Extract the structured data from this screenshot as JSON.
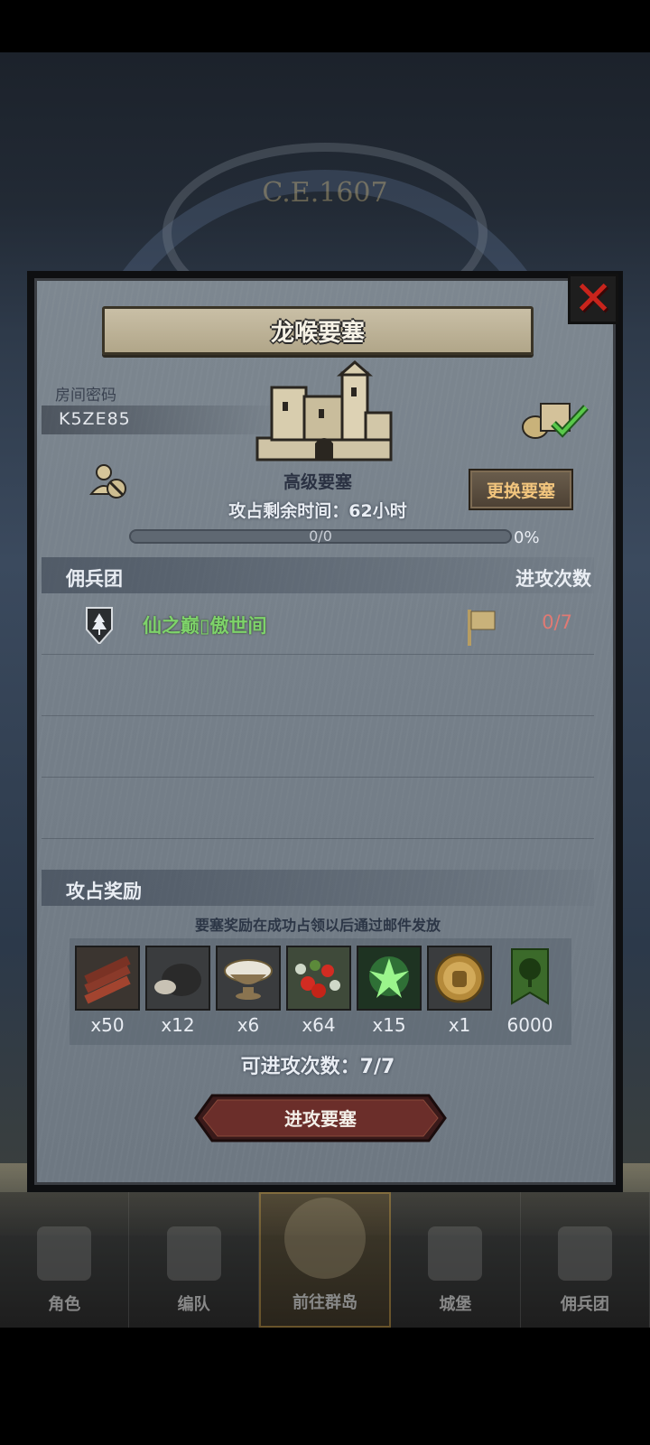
{
  "background": {
    "era_label": "C.E.1607"
  },
  "modal": {
    "title": "龙喉要塞",
    "room_password_label": "房间密码",
    "room_password": "K5ZE85",
    "fortress_type": "高级要塞",
    "change_button": "更换要塞",
    "remaining_time": "攻占剩余时间：62小时",
    "progress": {
      "text": "0/0",
      "percent_text": "0%",
      "value": 0
    },
    "mercenary_header": "佣兵团",
    "attack_count_header": "进攻次数",
    "mercenaries": [
      {
        "name": "仙之巅▯傲世间",
        "attacks": "0/7",
        "icon": "pine-tree-shield-icon"
      }
    ],
    "reward_header": "攻占奖励",
    "reward_note": "要塞奖励在成功占领以后通过邮件发放",
    "rewards": [
      {
        "icon": "wood-logs-icon",
        "qty": "x50"
      },
      {
        "icon": "ore-rock-icon",
        "qty": "x12"
      },
      {
        "icon": "silver-bowl-icon",
        "qty": "x6"
      },
      {
        "icon": "berries-icon",
        "qty": "x64"
      },
      {
        "icon": "green-spirit-icon",
        "qty": "x15"
      },
      {
        "icon": "knight-medal-icon",
        "qty": "x1"
      },
      {
        "icon": "tree-banner-icon",
        "qty": "6000"
      }
    ],
    "attack_remaining": "可进攻次数：7/7",
    "attack_button": "进攻要塞",
    "colors": {
      "accent_gold": "#f2c57d",
      "mercenary_green": "#7ed36a",
      "attack_red": "#e07a74",
      "close_red": "#c8241c"
    }
  },
  "bottom_nav": [
    {
      "label": "角色",
      "active": false
    },
    {
      "label": "编队",
      "active": false
    },
    {
      "label": "前往群岛",
      "active": true
    },
    {
      "label": "城堡",
      "active": false
    },
    {
      "label": "佣兵团",
      "active": false
    }
  ]
}
